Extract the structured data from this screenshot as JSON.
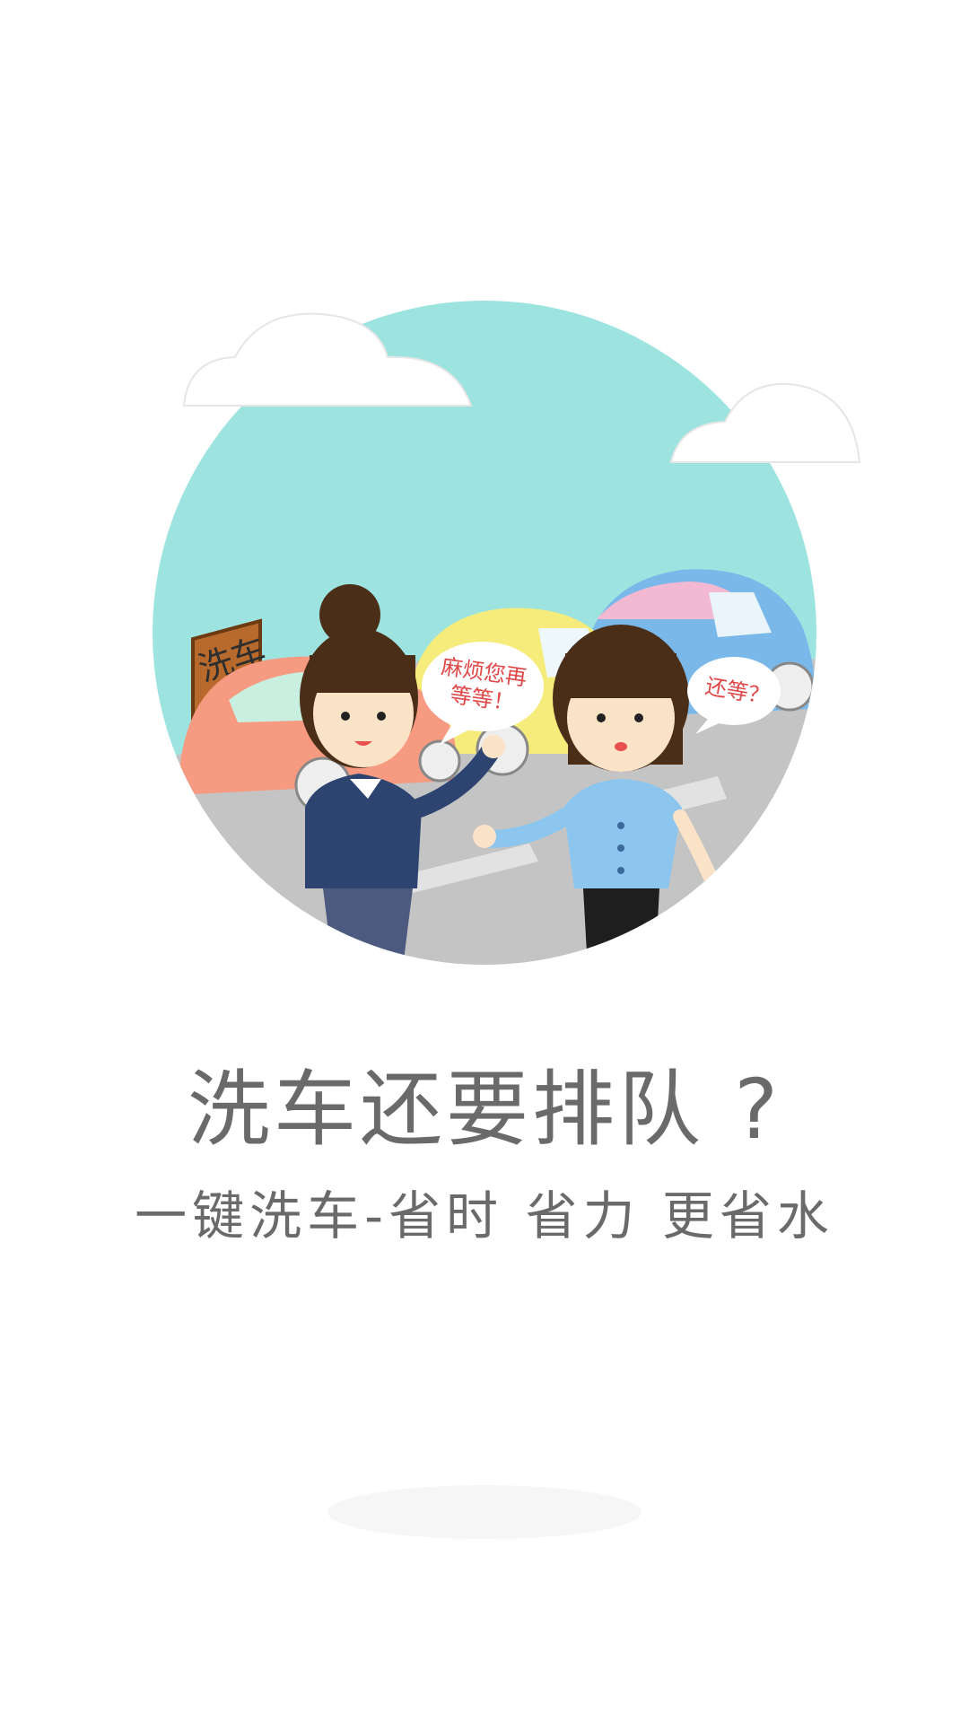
{
  "illustration": {
    "sign_text": "洗车",
    "bubble_left": {
      "line1": "麻烦您再",
      "line2": "等等！"
    },
    "bubble_right": "还等？"
  },
  "headline": {
    "title": "洗车还要排队 ?",
    "subtitle": "一键洗车-省时  省力  更省水"
  },
  "colors": {
    "sky": "#9de3df",
    "road": "#c4c4c4",
    "text": "#6a6a6a",
    "bubble_text": "#e04848"
  }
}
